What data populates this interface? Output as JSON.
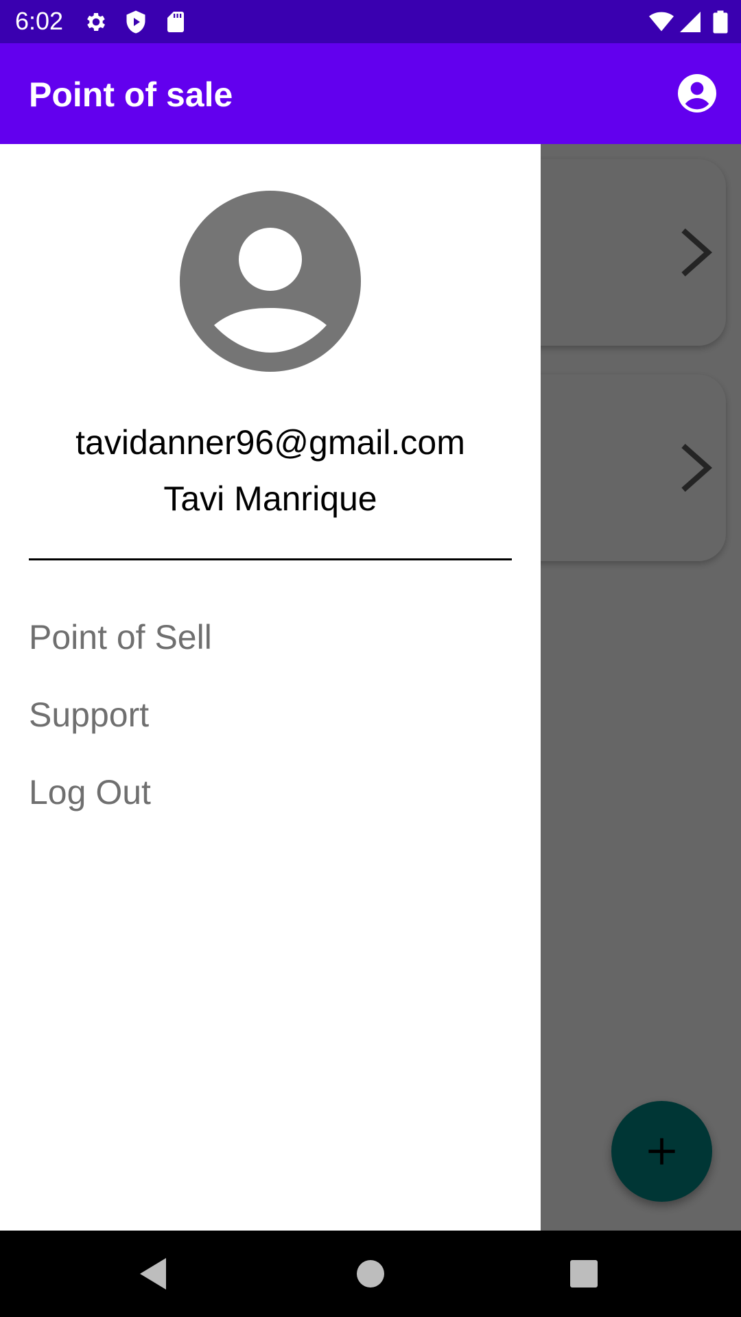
{
  "status_bar": {
    "time": "6:02",
    "icons": [
      "gear-icon",
      "shield-play-icon",
      "sd-card-icon",
      "wifi-icon",
      "cell-signal-icon",
      "battery-icon"
    ]
  },
  "app_bar": {
    "title": "Point of sale",
    "account_icon": "account-circle-icon",
    "color": "#6200ee",
    "status_color": "#3a00b0"
  },
  "drawer": {
    "avatar_icon": "account-circle-icon",
    "email": "tavidanner96@gmail.com",
    "name": "Tavi Manrique",
    "menu": [
      {
        "label": "Point of Sell"
      },
      {
        "label": "Support"
      },
      {
        "label": "Log Out"
      }
    ]
  },
  "content": {
    "card_count": 2,
    "card_icon": "chevron-right-icon",
    "fab_icon": "plus-icon",
    "fab_color": "#018786"
  },
  "nav_bar": {
    "icons": [
      "back-triangle-icon",
      "home-circle-icon",
      "recents-square-icon"
    ]
  }
}
